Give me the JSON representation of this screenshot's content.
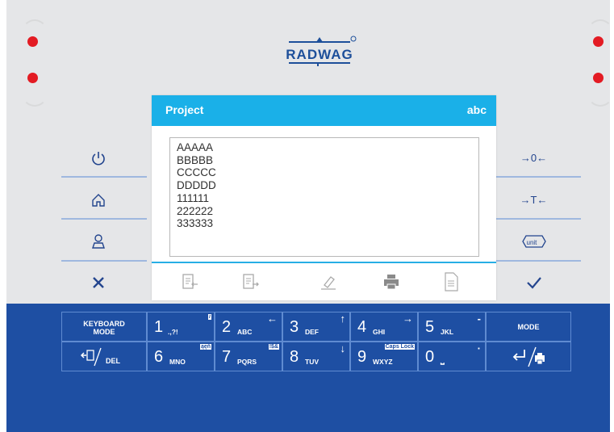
{
  "brand": {
    "logo_text": "RADWAG"
  },
  "indicators": {
    "left": [
      "status-led",
      "status-led"
    ],
    "right": [
      "status-led",
      "status-led"
    ],
    "color": "#e31b23"
  },
  "left_buttons": [
    {
      "name": "power-icon",
      "glyph": "⏻"
    },
    {
      "name": "home-icon",
      "glyph": "⌂"
    },
    {
      "name": "user-icon",
      "glyph": "♙"
    },
    {
      "name": "cancel-icon",
      "glyph": "✕"
    }
  ],
  "right_buttons": {
    "zero_label": "→0←",
    "tare_label": "→T←",
    "unit_label": "unit",
    "confirm_glyph": "✓"
  },
  "dialog": {
    "title": "Project",
    "mode": "abc",
    "lines": [
      "AAAAA",
      "BBBBB",
      "CCCCC",
      "DDDDD",
      "111111",
      "222222",
      "333333"
    ],
    "toolbar": [
      "import-icon",
      "export-icon",
      "eraser-icon",
      "printer-icon",
      "document-icon"
    ]
  },
  "keyboard": {
    "mode_label_1": "KEYBOARD",
    "mode_label_2": "MODE",
    "mode_label": "MODE",
    "del_label": "DEL",
    "keys_row1": [
      {
        "num": "1",
        "sub": ".,?!",
        "tag": "i"
      },
      {
        "num": "2",
        "sub": "ABC",
        "arrow": "←"
      },
      {
        "num": "3",
        "sub": "DEF",
        "arrow": "↑"
      },
      {
        "num": "4",
        "sub": "GHI",
        "arrow": "→"
      },
      {
        "num": "5",
        "sub": "JKL",
        "arrow": "-"
      }
    ],
    "keys_row2": [
      {
        "num": "6",
        "sub": "MNO",
        "tag": "ąęň"
      },
      {
        "num": "7",
        "sub": "PQRS",
        "tag": "!$&"
      },
      {
        "num": "8",
        "sub": "TUV",
        "arrow": "↓"
      },
      {
        "num": "9",
        "sub": "WXYZ",
        "tag": "Caps Lock"
      },
      {
        "num": "0",
        "sub": "⎵",
        "arrow": "·"
      }
    ],
    "accent_color": "#1e4fa3",
    "header_color": "#1ab0e8"
  }
}
